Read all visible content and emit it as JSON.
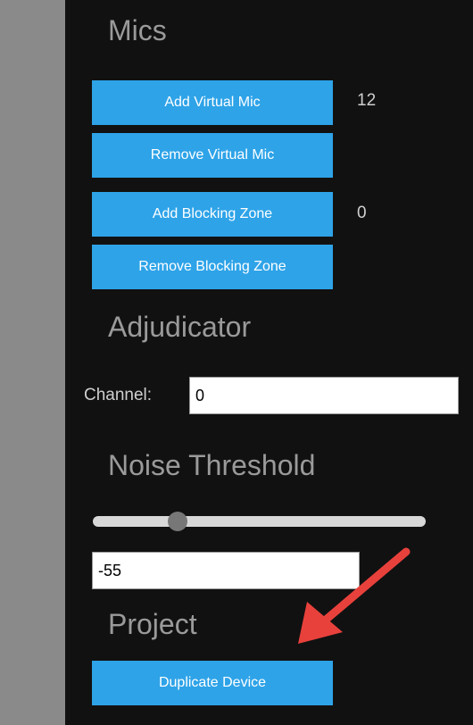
{
  "sections": {
    "mics": {
      "title": "Mics",
      "add_virtual_mic_label": "Add Virtual Mic",
      "remove_virtual_mic_label": "Remove Virtual Mic",
      "virtual_mic_count": "12",
      "add_blocking_zone_label": "Add Blocking Zone",
      "remove_blocking_zone_label": "Remove Blocking Zone",
      "blocking_zone_count": "0"
    },
    "adjudicator": {
      "title": "Adjudicator",
      "channel_label": "Channel:",
      "channel_value": "0"
    },
    "noise_threshold": {
      "title": "Noise Threshold",
      "value": "-55",
      "slider_fraction": 0.24
    },
    "project": {
      "title": "Project",
      "duplicate_device_label": "Duplicate Device"
    }
  },
  "colors": {
    "background": "#111111",
    "left_strip": "#8a8a8a",
    "button": "#2ea3e8",
    "heading": "#9a9a9a",
    "arrow": "#e8413c"
  },
  "icons": {
    "annotation": "arrow-icon"
  }
}
